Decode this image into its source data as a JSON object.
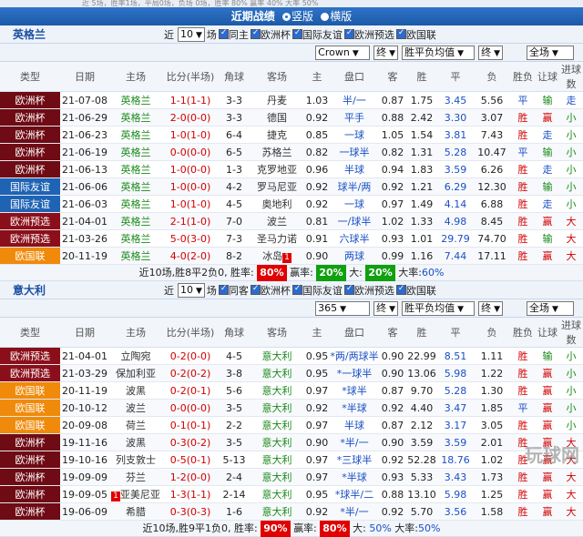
{
  "top_strip": "近 5场，胜率1场，平局0场，负场 0场，胜率 80%    赢率 40%   大率 50%",
  "banner": {
    "title": "近期战绩",
    "options": [
      "竖版",
      "横版"
    ]
  },
  "section1": {
    "team": "英格兰",
    "controls": {
      "recent_label": "近",
      "count": "10",
      "unit_label": "场",
      "filters": [
        "同主",
        "欧洲杯",
        "国际友谊",
        "欧洲预选",
        "欧国联"
      ],
      "company": "Crown",
      "period1": "终",
      "odds_type": "胜平负均值",
      "period2": "终",
      "scope": "全场"
    },
    "headers": {
      "type": "类型",
      "date": "日期",
      "home": "主场",
      "score": "比分(半场)",
      "corner": "角球",
      "away": "客场",
      "main": "主",
      "handicap": "盘口",
      "guest": "客",
      "win": "胜",
      "draw": "平",
      "lose": "负",
      "result": "胜负",
      "cover": "让球",
      "ou": "进球数"
    },
    "rows": [
      {
        "type": "欧洲杯",
        "tc": "#6e0b14",
        "date": "21-07-08",
        "home": "英格兰",
        "hc": "c-team",
        "score": "1-1(1-1)",
        "sc": "c-red",
        "corner": "3-3",
        "away": "丹麦",
        "ac": "c-gray",
        "m": "1.03",
        "hcp": "半/一",
        "g": "0.87",
        "w": "1.75",
        "d": "3.45",
        "l": "5.56",
        "r": "平",
        "rc": "c-blue",
        "cv": "输",
        "cc": "c-green",
        "ou": "走",
        "oc": "c-blue"
      },
      {
        "type": "欧洲杯",
        "tc": "#6e0b14",
        "date": "21-06-29",
        "home": "英格兰",
        "hc": "c-team",
        "score": "2-0(0-0)",
        "sc": "c-red",
        "corner": "3-3",
        "away": "德国",
        "ac": "c-gray",
        "m": "0.92",
        "hcp": "平手",
        "g": "0.88",
        "w": "2.42",
        "d": "3.30",
        "l": "3.07",
        "r": "胜",
        "rc": "c-red",
        "cv": "赢",
        "cc": "c-red",
        "ou": "小",
        "oc": "c-green"
      },
      {
        "type": "欧洲杯",
        "tc": "#6e0b14",
        "date": "21-06-23",
        "home": "英格兰",
        "hc": "c-team",
        "score": "1-0(1-0)",
        "sc": "c-red",
        "corner": "6-4",
        "away": "捷克",
        "ac": "c-gray",
        "m": "0.85",
        "hcp": "一球",
        "g": "1.05",
        "w": "1.54",
        "d": "3.81",
        "l": "7.43",
        "r": "胜",
        "rc": "c-red",
        "cv": "走",
        "cc": "c-blue",
        "ou": "小",
        "oc": "c-green"
      },
      {
        "type": "欧洲杯",
        "tc": "#6e0b14",
        "date": "21-06-19",
        "home": "英格兰",
        "hc": "c-team",
        "score": "0-0(0-0)",
        "sc": "c-red",
        "corner": "6-5",
        "away": "苏格兰",
        "ac": "c-gray",
        "m": "0.82",
        "hcp": "一球半",
        "g": "0.82",
        "w": "1.31",
        "d": "5.28",
        "l": "10.47",
        "r": "平",
        "rc": "c-blue",
        "cv": "输",
        "cc": "c-green",
        "ou": "小",
        "oc": "c-green"
      },
      {
        "type": "欧洲杯",
        "tc": "#6e0b14",
        "date": "21-06-13",
        "home": "英格兰",
        "hc": "c-team",
        "score": "1-0(0-0)",
        "sc": "c-red",
        "corner": "1-3",
        "away": "克罗地亚",
        "ac": "c-gray",
        "m": "0.96",
        "hcp": "半球",
        "g": "0.94",
        "w": "1.83",
        "d": "3.59",
        "l": "6.26",
        "r": "胜",
        "rc": "c-red",
        "cv": "走",
        "cc": "c-blue",
        "ou": "小",
        "oc": "c-green"
      },
      {
        "type": "国际友谊",
        "tc": "#1f63b4",
        "date": "21-06-06",
        "home": "英格兰",
        "hc": "c-team",
        "score": "1-0(0-0)",
        "sc": "c-red",
        "corner": "4-2",
        "away": "罗马尼亚",
        "ac": "c-gray",
        "m": "0.92",
        "hcp": "球半/两",
        "g": "0.92",
        "w": "1.21",
        "d": "6.29",
        "l": "12.30",
        "r": "胜",
        "rc": "c-red",
        "cv": "输",
        "cc": "c-green",
        "ou": "小",
        "oc": "c-green"
      },
      {
        "type": "国际友谊",
        "tc": "#1f63b4",
        "date": "21-06-03",
        "home": "英格兰",
        "hc": "c-team",
        "score": "1-0(1-0)",
        "sc": "c-red",
        "corner": "4-5",
        "away": "奥地利",
        "ac": "c-gray",
        "m": "0.92",
        "hcp": "一球",
        "g": "0.97",
        "w": "1.49",
        "d": "4.14",
        "l": "6.88",
        "r": "胜",
        "rc": "c-red",
        "cv": "走",
        "cc": "c-blue",
        "ou": "小",
        "oc": "c-green"
      },
      {
        "type": "欧洲预选",
        "tc": "#8b0f1a",
        "date": "21-04-01",
        "home": "英格兰",
        "hc": "c-team",
        "score": "2-1(1-0)",
        "sc": "c-red",
        "corner": "7-0",
        "away": "波兰",
        "ac": "c-gray",
        "m": "0.81",
        "hcp": "一/球半",
        "g": "1.02",
        "w": "1.33",
        "d": "4.98",
        "l": "8.45",
        "r": "胜",
        "rc": "c-red",
        "cv": "赢",
        "cc": "c-red",
        "ou": "大",
        "oc": "c-red"
      },
      {
        "type": "欧洲预选",
        "tc": "#8b0f1a",
        "date": "21-03-26",
        "home": "英格兰",
        "hc": "c-team",
        "score": "5-0(3-0)",
        "sc": "c-red",
        "corner": "7-3",
        "away": "圣马力诺",
        "ac": "c-gray",
        "m": "0.91",
        "hcp": "六球半",
        "g": "0.93",
        "w": "1.01",
        "d": "29.79",
        "l": "74.70",
        "r": "胜",
        "rc": "c-red",
        "cv": "输",
        "cc": "c-green",
        "ou": "大",
        "oc": "c-red"
      },
      {
        "type": "欧国联",
        "tc": "#f08a0a",
        "date": "20-11-19",
        "home": "英格兰",
        "hc": "c-team",
        "score": "4-0(2-0)",
        "sc": "c-red",
        "corner": "8-2",
        "away": "冰岛",
        "ac": "c-gray",
        "redcard": "1",
        "m": "0.90",
        "hcp": "两球",
        "g": "0.99",
        "w": "1.16",
        "d": "7.44",
        "l": "17.11",
        "r": "胜",
        "rc": "c-red",
        "cv": "赢",
        "cc": "c-red",
        "ou": "大",
        "oc": "c-red"
      }
    ],
    "summary": {
      "text": "近10场,胜8平2负0, 胜率:",
      "win_rate": "80%",
      "cover_label": "赢率:",
      "cover_rate": "20%",
      "big_label": "大:",
      "big_rate": "20%",
      "over_label": "大率:",
      "over_rate": "60%"
    }
  },
  "section2": {
    "team": "意大利",
    "controls": {
      "recent_label": "近",
      "count": "10",
      "unit_label": "场",
      "filters": [
        "同客",
        "欧洲杯",
        "国际友谊",
        "欧洲预选",
        "欧国联"
      ],
      "company": "365",
      "period1": "终",
      "odds_type": "胜平负均值",
      "period2": "终",
      "scope": "全场"
    },
    "headers": {
      "type": "类型",
      "date": "日期",
      "home": "主场",
      "score": "比分(半场)",
      "corner": "角球",
      "away": "客场",
      "main": "主",
      "handicap": "盘口",
      "guest": "客",
      "win": "胜",
      "draw": "平",
      "lose": "负",
      "result": "胜负",
      "cover": "让球",
      "ou": "进球数"
    },
    "rows": [
      {
        "type": "欧洲预选",
        "tc": "#8b0f1a",
        "date": "21-04-01",
        "home": "立陶宛",
        "hc": "c-gray",
        "score": "0-2(0-0)",
        "sc": "c-red",
        "corner": "4-5",
        "away": "意大利",
        "ac": "c-team",
        "m": "0.95",
        "hcp": "*两/两球半",
        "g": "0.90",
        "w": "22.99",
        "d": "8.51",
        "l": "1.11",
        "r": "胜",
        "rc": "c-red",
        "cv": "输",
        "cc": "c-green",
        "ou": "小",
        "oc": "c-green"
      },
      {
        "type": "欧洲预选",
        "tc": "#8b0f1a",
        "date": "21-03-29",
        "home": "保加利亚",
        "hc": "c-gray",
        "score": "0-2(0-2)",
        "sc": "c-red",
        "corner": "3-8",
        "away": "意大利",
        "ac": "c-team",
        "m": "0.95",
        "hcp": "*一球半",
        "g": "0.90",
        "w": "13.06",
        "d": "5.98",
        "l": "1.22",
        "r": "胜",
        "rc": "c-red",
        "cv": "赢",
        "cc": "c-red",
        "ou": "小",
        "oc": "c-green"
      },
      {
        "type": "欧国联",
        "tc": "#f08a0a",
        "date": "20-11-19",
        "home": "波黑",
        "hc": "c-gray",
        "score": "0-2(0-1)",
        "sc": "c-red",
        "corner": "5-6",
        "away": "意大利",
        "ac": "c-team",
        "m": "0.97",
        "hcp": "*球半",
        "g": "0.87",
        "w": "9.70",
        "d": "5.28",
        "l": "1.30",
        "r": "胜",
        "rc": "c-red",
        "cv": "赢",
        "cc": "c-red",
        "ou": "小",
        "oc": "c-green"
      },
      {
        "type": "欧国联",
        "tc": "#f08a0a",
        "date": "20-10-12",
        "home": "波兰",
        "hc": "c-gray",
        "score": "0-0(0-0)",
        "sc": "c-red",
        "corner": "3-5",
        "away": "意大利",
        "ac": "c-team",
        "m": "0.92",
        "hcp": "*半球",
        "g": "0.92",
        "w": "4.40",
        "d": "3.47",
        "l": "1.85",
        "r": "平",
        "rc": "c-blue",
        "cv": "赢",
        "cc": "c-red",
        "ou": "小",
        "oc": "c-green"
      },
      {
        "type": "欧国联",
        "tc": "#f08a0a",
        "date": "20-09-08",
        "home": "荷兰",
        "hc": "c-gray",
        "score": "0-1(0-1)",
        "sc": "c-red",
        "corner": "2-2",
        "away": "意大利",
        "ac": "c-team",
        "m": "0.97",
        "hcp": "半球",
        "g": "0.87",
        "w": "2.12",
        "d": "3.17",
        "l": "3.05",
        "r": "胜",
        "rc": "c-red",
        "cv": "赢",
        "cc": "c-red",
        "ou": "小",
        "oc": "c-green"
      },
      {
        "type": "欧洲杯",
        "tc": "#6e0b14",
        "date": "19-11-16",
        "home": "波黑",
        "hc": "c-gray",
        "score": "0-3(0-2)",
        "sc": "c-red",
        "corner": "3-5",
        "away": "意大利",
        "ac": "c-team",
        "m": "0.90",
        "hcp": "*半/一",
        "g": "0.90",
        "w": "3.59",
        "d": "3.59",
        "l": "2.01",
        "r": "胜",
        "rc": "c-red",
        "cv": "赢",
        "cc": "c-red",
        "ou": "大",
        "oc": "c-red"
      },
      {
        "type": "欧洲杯",
        "tc": "#6e0b14",
        "date": "19-10-16",
        "home": "列支敦士",
        "hc": "c-gray",
        "score": "0-5(0-1)",
        "sc": "c-red",
        "corner": "5-13",
        "away": "意大利",
        "ac": "c-team",
        "m": "0.97",
        "hcp": "*三球半",
        "g": "0.92",
        "w": "52.28",
        "d": "18.76",
        "l": "1.02",
        "r": "胜",
        "rc": "c-red",
        "cv": "赢",
        "cc": "c-red",
        "ou": "大",
        "oc": "c-red"
      },
      {
        "type": "欧洲杯",
        "tc": "#6e0b14",
        "date": "19-09-09",
        "home": "芬兰",
        "hc": "c-gray",
        "score": "1-2(0-0)",
        "sc": "c-red",
        "corner": "2-4",
        "away": "意大利",
        "ac": "c-team",
        "m": "0.97",
        "hcp": "*半球",
        "g": "0.93",
        "w": "5.33",
        "d": "3.43",
        "l": "1.73",
        "r": "胜",
        "rc": "c-red",
        "cv": "赢",
        "cc": "c-red",
        "ou": "大",
        "oc": "c-red"
      },
      {
        "type": "欧洲杯",
        "tc": "#6e0b14",
        "date": "19-09-05",
        "home": "亚美尼亚",
        "hc": "c-gray",
        "homecard": "1",
        "score": "1-3(1-1)",
        "sc": "c-red",
        "corner": "2-14",
        "away": "意大利",
        "ac": "c-team",
        "m": "0.95",
        "hcp": "*球半/二",
        "g": "0.88",
        "w": "13.10",
        "d": "5.98",
        "l": "1.25",
        "r": "胜",
        "rc": "c-red",
        "cv": "赢",
        "cc": "c-red",
        "ou": "大",
        "oc": "c-red"
      },
      {
        "type": "欧洲杯",
        "tc": "#6e0b14",
        "date": "19-06-09",
        "home": "希腊",
        "hc": "c-gray",
        "score": "0-3(0-3)",
        "sc": "c-red",
        "corner": "1-6",
        "away": "意大利",
        "ac": "c-team",
        "m": "0.92",
        "hcp": "*半/一",
        "g": "0.92",
        "w": "5.70",
        "d": "3.56",
        "l": "1.58",
        "r": "胜",
        "rc": "c-red",
        "cv": "赢",
        "cc": "c-red",
        "ou": "大",
        "oc": "c-red"
      }
    ],
    "summary": {
      "text": "近10场,胜9平1负0, 胜率:",
      "win_rate": "90%",
      "cover_label": "赢率:",
      "cover_rate": "80%",
      "big_label": "大:",
      "big_rate": "50%",
      "over_label": "大率:",
      "over_rate": "50%"
    }
  },
  "watermark": "玩球网"
}
